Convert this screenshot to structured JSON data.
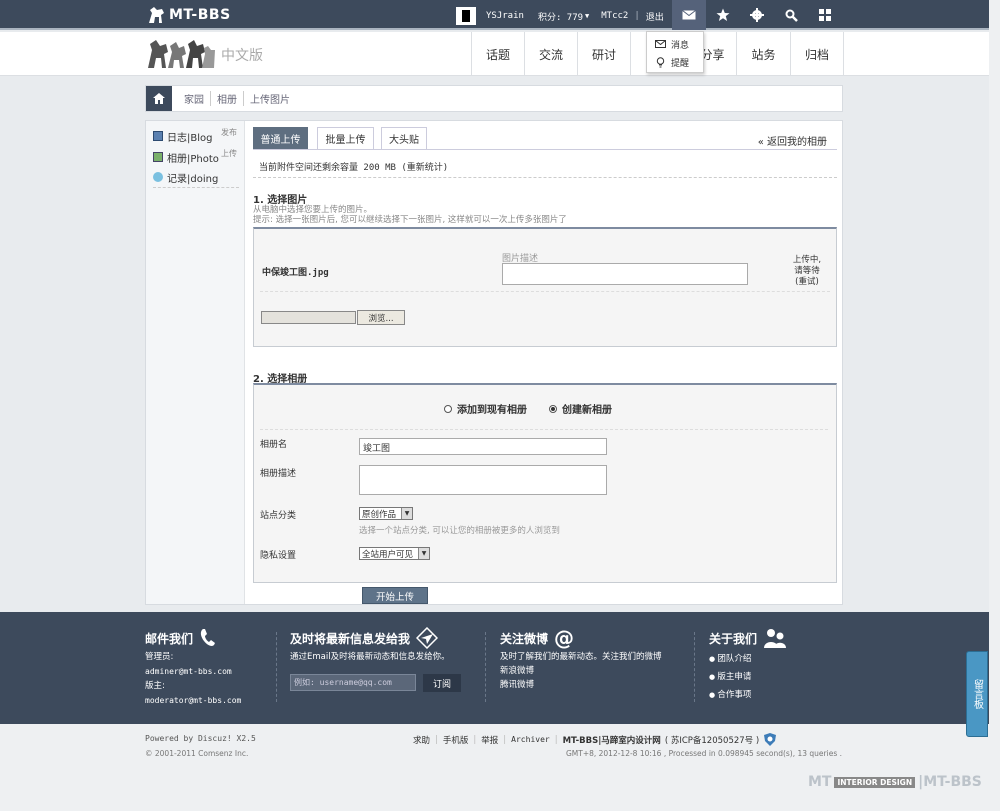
{
  "topbar": {
    "logo_text": "MT-BBS",
    "username": "YSJrain",
    "points_label": "积分: 779",
    "group": "MTcc2",
    "logout": "退出"
  },
  "notifications": {
    "message": "消息",
    "remind": "提醒"
  },
  "navbar": {
    "site_sub": "中文版",
    "items": [
      "话题",
      "交流",
      "研讨",
      "分享",
      "站务",
      "归档"
    ]
  },
  "breadcrumb": [
    "家园",
    "相册",
    "上传图片"
  ],
  "sidebar": {
    "items": [
      {
        "label": "日志|Blog",
        "post": "发布"
      },
      {
        "label": "相册|Photo",
        "post": "上传"
      },
      {
        "label": "记录|doing",
        "post": ""
      }
    ]
  },
  "tabs": [
    "普通上传",
    "批量上传",
    "大头贴"
  ],
  "back_link": "« 返回我的相册",
  "quota_text": "当前附件空间还剩余容量 200 MB (重新统计)",
  "section1": {
    "title": "1. 选择图片",
    "hint1": "从电脑中选择您要上传的图片。",
    "hint2": "提示: 选择一张图片后, 您可以继续选择下一张图片, 这样就可以一次上传多张图片了",
    "file_name": "中保竣工图.jpg",
    "desc_label": "图片描述",
    "status": [
      "上传中,",
      "请等待",
      "(重试)"
    ],
    "browse": "浏览..."
  },
  "section2": {
    "title": "2. 选择相册",
    "option_existing": "添加到现有相册",
    "option_new": "创建新相册",
    "name_label": "相册名",
    "name_value": "竣工图",
    "desc_label": "相册描述",
    "category_label": "站点分类",
    "category_value": "原创作品",
    "category_hint": "选择一个站点分类, 可以让您的相册被更多的人浏览到",
    "privacy_label": "隐私设置",
    "privacy_value": "全站用户可见"
  },
  "start_button": "开始上传",
  "footer": {
    "col1": {
      "title": "邮件我们",
      "lines": [
        "管理员:",
        "adminer@mt-bbs.com",
        "版主:",
        "moderator@mt-bbs.com"
      ]
    },
    "col2": {
      "title": "及时将最新信息发给我",
      "desc": "通过Email及时将最新动态和信息发给你。",
      "placeholder": "例如: username@qq.com",
      "button": "订阅"
    },
    "col3": {
      "title": "关注微博",
      "lines": [
        "及时了解我们的最新动态。关注我们的微博",
        "新浪微博",
        "腾讯微博"
      ]
    },
    "col4": {
      "title": "关于我们",
      "lines": [
        "团队介绍",
        "版主申请",
        "合作事项"
      ]
    }
  },
  "bottom": {
    "powered": "Powered by Discuz! X2.5",
    "copyright": "© 2001-2011 Comsenz Inc.",
    "links": [
      "求助",
      "手机版",
      "举报",
      "Archiver",
      "MT-BBS|马蹄室内设计网",
      "( 苏ICP备12050527号 )"
    ],
    "gmt": "GMT+8, 2012-12-8 10:16 , Processed in 0.098945 second(s), 13 queries .",
    "watermark_left": "MT",
    "watermark_badge": "INTERIOR DESIGN",
    "watermark_right": "|MT-BBS"
  },
  "sidetab": "留言板"
}
